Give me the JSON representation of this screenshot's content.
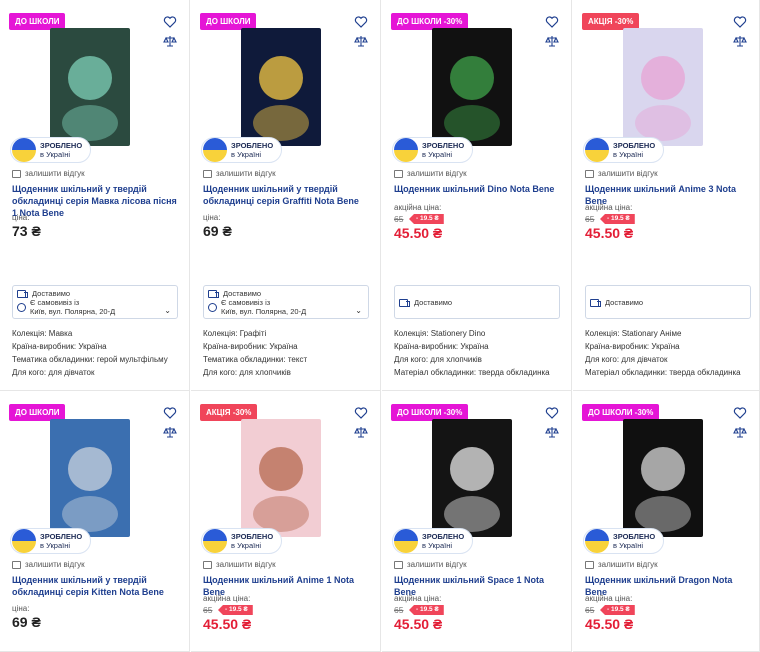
{
  "labels": {
    "made_in_1": "ЗРОБЛЕНО",
    "made_in_2": "в Україні",
    "review": "залишити відгук",
    "price_label": "ціна:",
    "sale_price_label": "акційна ціна:",
    "delivery": "Доставимо",
    "pickup_1": "Є самовивіз із",
    "pickup_2": "Київ, вул. Полярна, 20-Д"
  },
  "products": [
    {
      "badge": "ДО ШКОЛИ",
      "badge_type": "school",
      "title": "Щоденник шкільний у твердій обкладинці серія Мавка лісова пісня 1 Nota Bene",
      "price": "73 ₴",
      "old_price": null,
      "discount": null,
      "pickup": true,
      "attrs": [
        "Колекція: Мавка",
        "Країна-виробник: Україна",
        "Тематика обкладинки: герой мультфільму",
        "Для кого: для дівчаток"
      ],
      "cover": {
        "bg": "#2b4a3f",
        "accent": "#7fd0b8",
        "label": ""
      }
    },
    {
      "badge": "ДО ШКОЛИ",
      "badge_type": "school",
      "title": "Щоденник шкільний у твердій обкладинці серія Graffiti Nota Bene",
      "price": "69 ₴",
      "old_price": null,
      "discount": null,
      "pickup": true,
      "attrs": [
        "Колекція: Графіті",
        "Країна-виробник: Україна",
        "Тематика обкладинки: текст",
        "Для кого: для хлопчиків"
      ],
      "cover": {
        "bg": "#0f1a3a",
        "accent": "#f6c843",
        "label": "UKRAINE"
      }
    },
    {
      "badge": "ДО ШКОЛИ -30%",
      "badge_type": "school",
      "title": "Щоденник шкільний Dino Nota Bene",
      "price": "45.50 ₴",
      "old_price": "65",
      "discount": "- 19.5 ₴",
      "pickup": false,
      "attrs": [
        "Колекція: Stationery Dino",
        "Країна-виробник: Україна",
        "Для кого: для хлопчиків",
        "Матеріал обкладинки: тверда обкладинка"
      ],
      "cover": {
        "bg": "#111111",
        "accent": "#3fa34a",
        "label": "ЩОДЕННИК"
      }
    },
    {
      "badge": "АКЦІЯ -30%",
      "badge_type": "sale",
      "title": "Щоденник шкільний Anime 3 Nota Bene",
      "price": "45.50 ₴",
      "old_price": "65",
      "discount": "- 19.5 ₴",
      "pickup": false,
      "attrs": [
        "Колекція: Stationary Аніме",
        "Країна-виробник: Україна",
        "Для кого: для дівчаток",
        "Матеріал обкладинки: тверда обкладинка"
      ],
      "cover": {
        "bg": "#d9d6ee",
        "accent": "#e7a3d4",
        "label": "ЩОДЕННИК"
      }
    },
    {
      "badge": "ДО ШКОЛИ",
      "badge_type": "school",
      "title": "Щоденник шкільний у твердій обкладинці серія Kitten Nota Bene",
      "price": "69 ₴",
      "old_price": null,
      "discount": null,
      "pickup": null,
      "attrs": [],
      "cover": {
        "bg": "#3b6fb0",
        "accent": "#c9d2de",
        "label": "Щоденник"
      }
    },
    {
      "badge": "АКЦІЯ -30%",
      "badge_type": "sale",
      "title": "Щоденник шкільний Anime 1 Nota Bene",
      "price": "45.50 ₴",
      "old_price": "65",
      "discount": "- 19.5 ₴",
      "pickup": null,
      "attrs": [],
      "cover": {
        "bg": "#f2cdd3",
        "accent": "#b5684f",
        "label": "ЩОДЕННИК"
      }
    },
    {
      "badge": "ДО ШКОЛИ -30%",
      "badge_type": "school",
      "title": "Щоденник шкільний Space 1 Nota Bene",
      "price": "45.50 ₴",
      "old_price": "65",
      "discount": "- 19.5 ₴",
      "pickup": null,
      "attrs": [],
      "cover": {
        "bg": "#141414",
        "accent": "#e8e8e8",
        "label": "ЩОДЕННИК"
      }
    },
    {
      "badge": "ДО ШКОЛИ -30%",
      "badge_type": "school",
      "title": "Щоденник шкільний Dragon Nota Bene",
      "price": "45.50 ₴",
      "old_price": "65",
      "discount": "- 19.5 ₴",
      "pickup": null,
      "attrs": [],
      "cover": {
        "bg": "#101010",
        "accent": "#d8d8d8",
        "label": "ЩОДЕННИК"
      }
    }
  ]
}
